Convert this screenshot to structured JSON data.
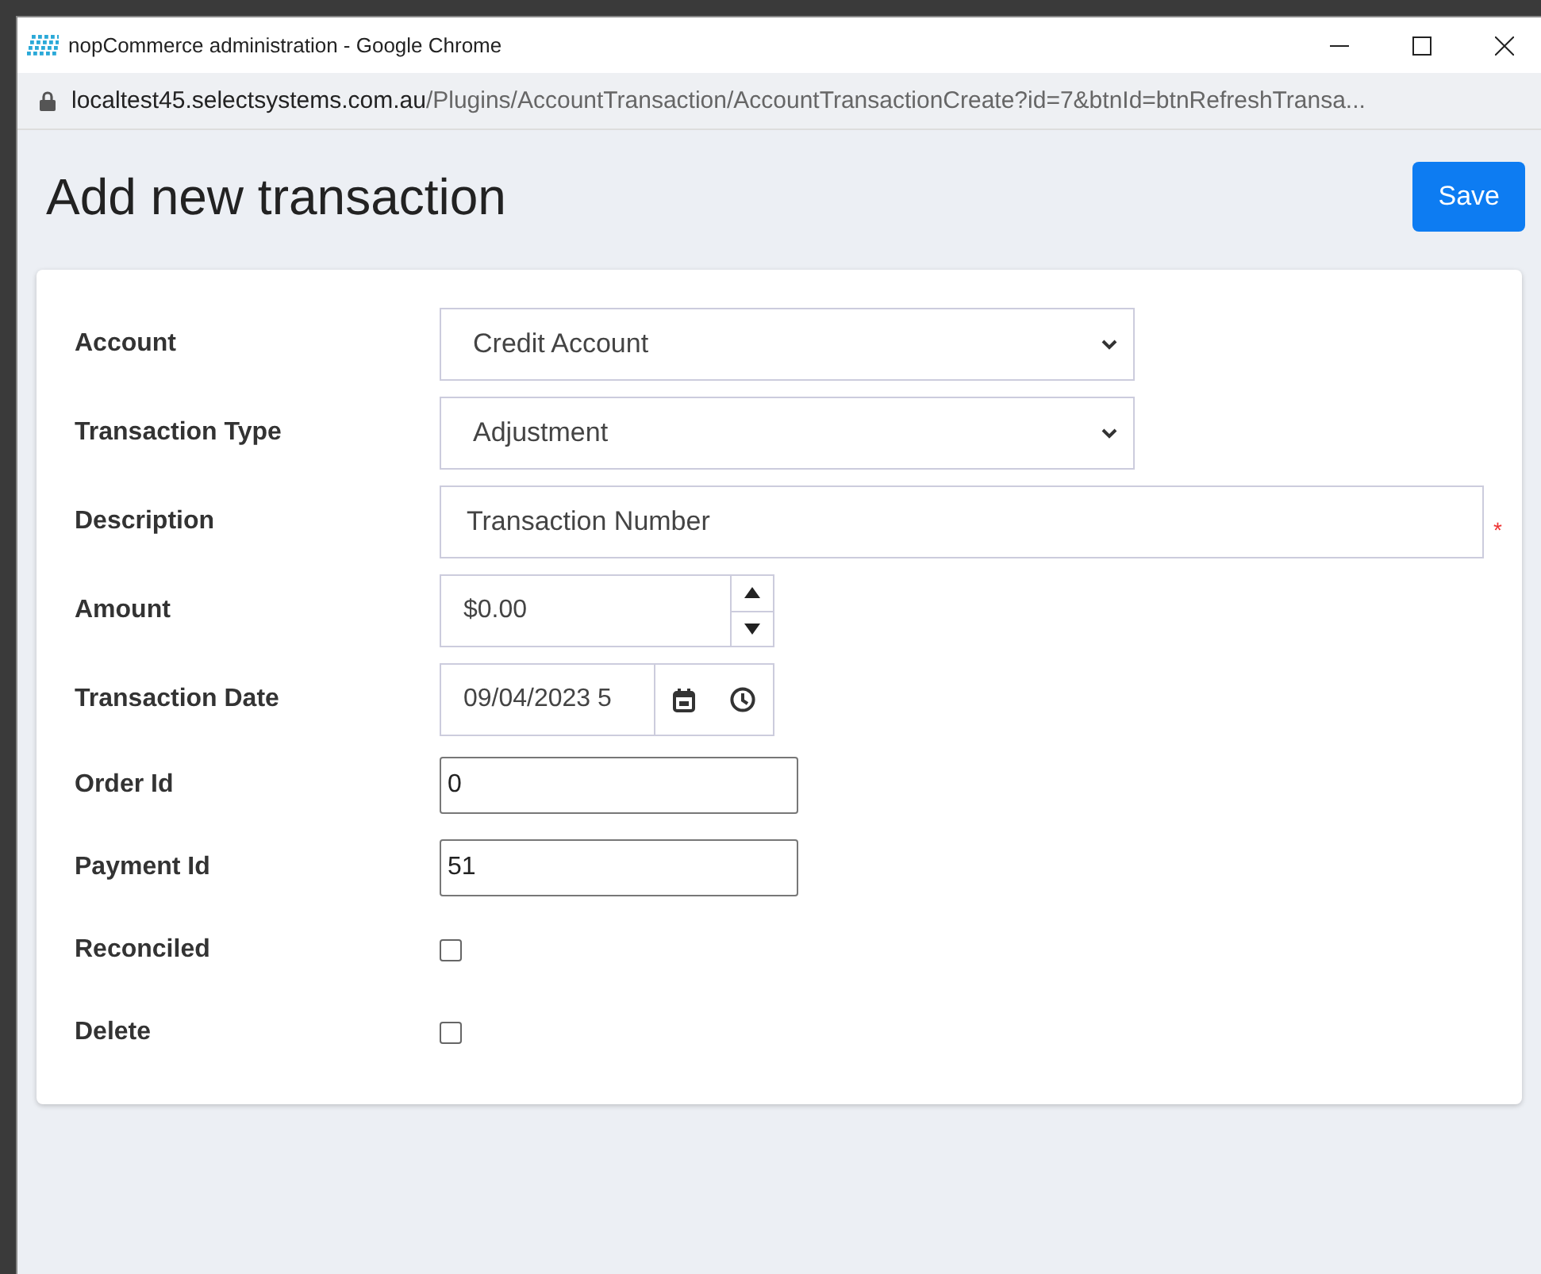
{
  "window": {
    "title": "nopCommerce administration - Google Chrome"
  },
  "address_bar": {
    "host": "localtest45.selectsystems.com.au",
    "path": "/Plugins/AccountTransaction/AccountTransactionCreate?id=7&btnId=btnRefreshTransa..."
  },
  "page": {
    "title": "Add new transaction",
    "save_button": "Save"
  },
  "fields": [
    {
      "kind": "select",
      "label": "Account",
      "value": "Credit Account"
    },
    {
      "kind": "select",
      "label": "Transaction Type",
      "value": "Adjustment"
    },
    {
      "kind": "text",
      "label": "Description",
      "value": "Transaction Number",
      "required_mark": "*"
    },
    {
      "kind": "spinner",
      "label": "Amount",
      "value": "$0.00"
    },
    {
      "kind": "datetime",
      "label": "Transaction Date",
      "value": "09/04/2023 5"
    },
    {
      "kind": "plain",
      "label": "Order Id",
      "value": "0"
    },
    {
      "kind": "plain",
      "label": "Payment Id",
      "value": "51"
    },
    {
      "kind": "checkbox",
      "label": "Reconciled",
      "checked": false
    },
    {
      "kind": "checkbox",
      "label": "Delete",
      "checked": false
    }
  ]
}
